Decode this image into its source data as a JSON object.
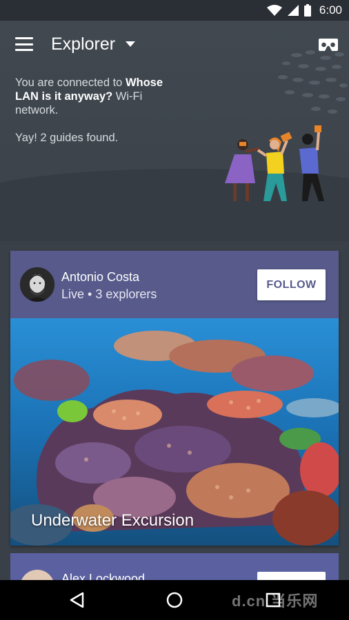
{
  "status_bar": {
    "time": "6:00",
    "icons": [
      "wifi-icon",
      "signal-icon",
      "battery-icon"
    ]
  },
  "toolbar": {
    "title": "Explorer",
    "menu_icon": "hamburger-menu-icon",
    "dropdown_icon": "dropdown-arrow-icon",
    "vr_icon": "cardboard-vr-icon"
  },
  "connection": {
    "prefix": "You are connected to ",
    "network_name": "Whose LAN is it anyway?",
    "suffix": " Wi-Fi network."
  },
  "guides_found": "Yay! 2 guides found.",
  "cards": [
    {
      "guide_name": "Antonio Costa",
      "status": "Live • 3 explorers",
      "follow_label": "FOLLOW",
      "expedition_title": "Underwater Excursion"
    },
    {
      "guide_name": "Alex Lockwood"
    }
  ],
  "nav_bar": {
    "icons": [
      "back-icon",
      "home-icon",
      "recents-icon"
    ],
    "watermark": "d.cn 当乐网"
  },
  "colors": {
    "background": "#3a4048",
    "card_accent": "#575a8a",
    "status_bar": "#2a2f35"
  }
}
